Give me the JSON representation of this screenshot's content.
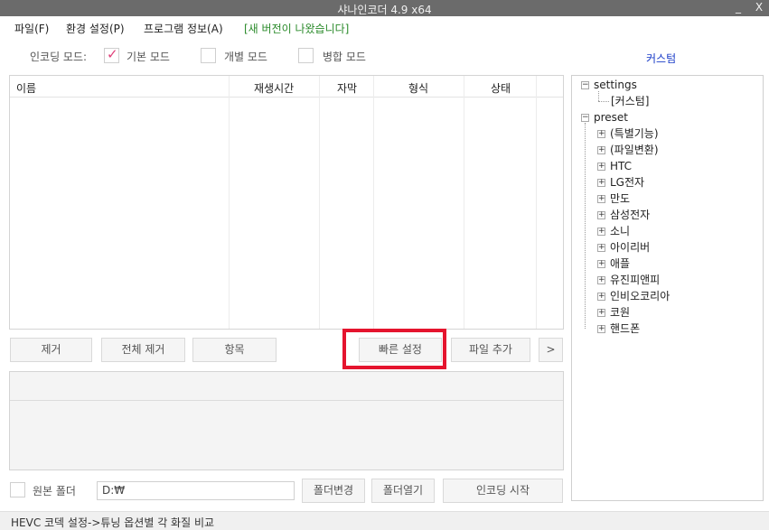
{
  "window": {
    "title": "샤나인코더 4.9 x64",
    "minimize": "_",
    "close": "X"
  },
  "menu": {
    "file": "파일(F)",
    "settings": "환경 설정(P)",
    "about": "프로그램 정보(A)",
    "update_notice": "[새 버전이 나왔습니다]"
  },
  "mode": {
    "label": "인코딩 모드:",
    "options": [
      {
        "label": "기본 모드",
        "checked": true
      },
      {
        "label": "개별 모드",
        "checked": false
      },
      {
        "label": "병합 모드",
        "checked": false
      }
    ]
  },
  "custom_label": "커스텀",
  "file_list": {
    "columns": [
      "이름",
      "재생시간",
      "자막",
      "형식",
      "상태"
    ]
  },
  "buttons": {
    "remove": "제거",
    "remove_all": "전체 제거",
    "items": "항목",
    "quick_settings": "빠른 설정",
    "add_file": "파일 추가",
    "more": ">",
    "change_folder": "폴더변경",
    "open_folder": "폴더열기",
    "start_encoding": "인코딩 시작"
  },
  "source_folder": {
    "label": "원본 폴더",
    "checked": false,
    "path": "D:₩"
  },
  "tree": {
    "settings": {
      "label": "settings",
      "children": [
        "[커스텀]"
      ]
    },
    "preset": {
      "label": "preset",
      "children": [
        "(특별기능)",
        "(파일변환)",
        "HTC",
        "LG전자",
        "만도",
        "삼성전자",
        "소니",
        "아이리버",
        "애플",
        "유진피앤피",
        "인비오코리아",
        "코원",
        "핸드폰"
      ]
    }
  },
  "status_text": "HEVC 코덱 설정->튜닝 옵션별 각 화질 비교"
}
